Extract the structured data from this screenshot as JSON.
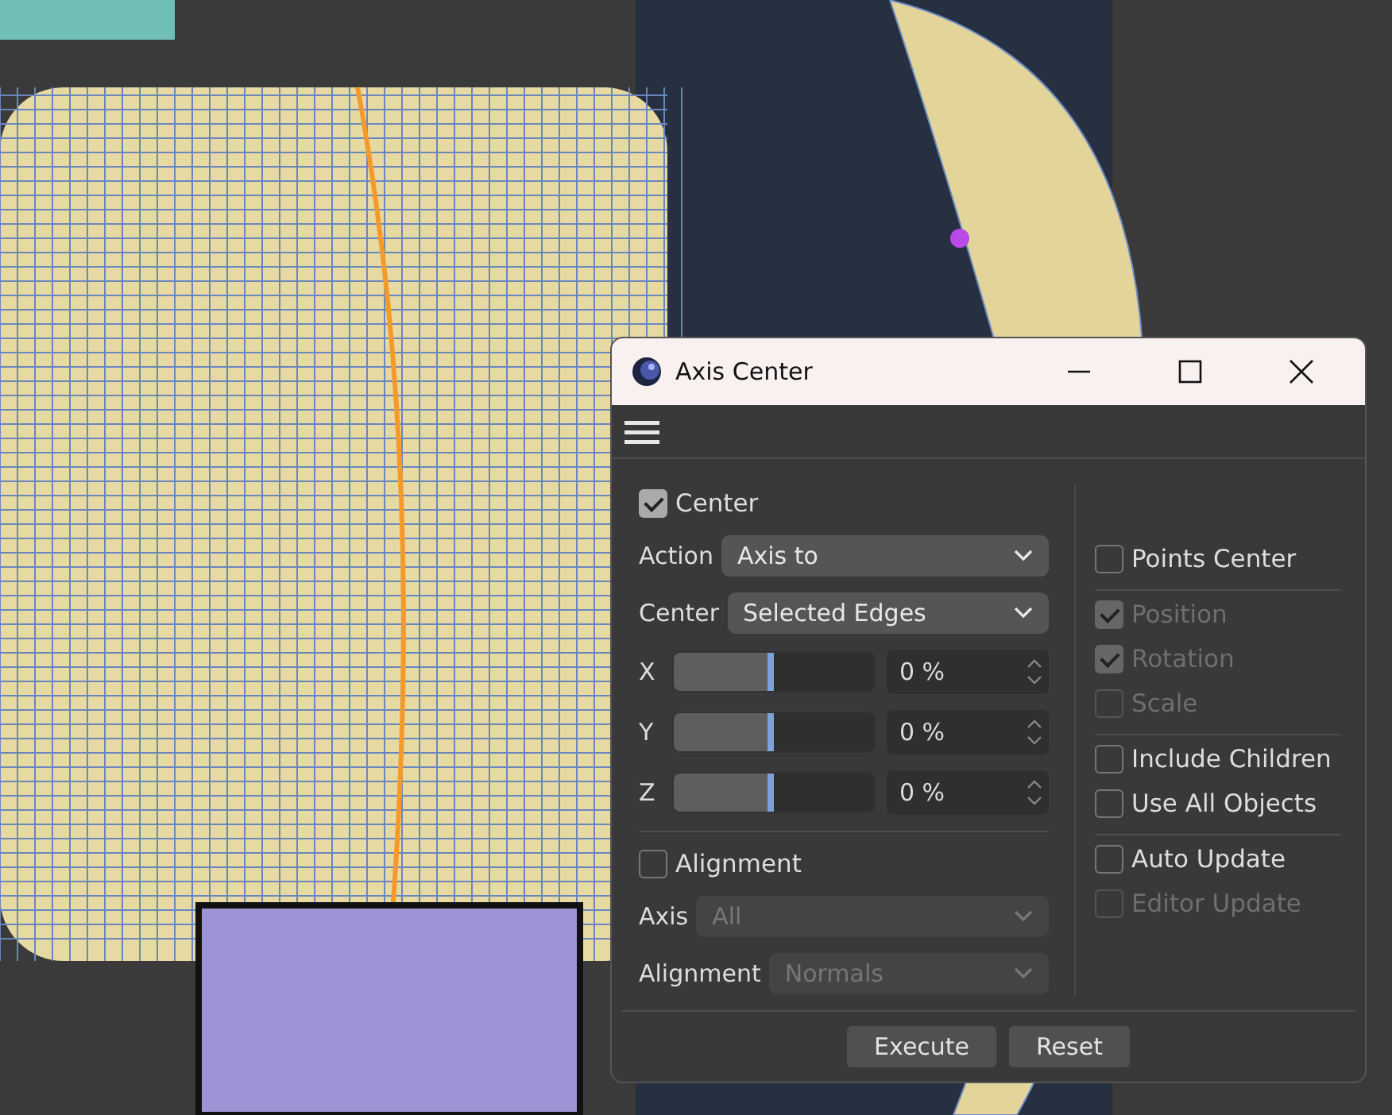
{
  "window": {
    "title": "Axis Center"
  },
  "center": {
    "label": "Center",
    "checked": true
  },
  "dropdowns": [
    {
      "label": "Action",
      "value": "Axis to",
      "disabled": false
    },
    {
      "label": "Center",
      "value": "Selected Edges",
      "disabled": false
    }
  ],
  "sliders": [
    {
      "label": "X",
      "level": 0.5,
      "value": "0 %"
    },
    {
      "label": "Y",
      "level": 0.5,
      "value": "0 %"
    },
    {
      "label": "Z",
      "level": 0.5,
      "value": "0 %"
    }
  ],
  "alignment": {
    "label": "Alignment",
    "checked": false
  },
  "alignment_dropdowns": [
    {
      "label": "Axis",
      "value": "All",
      "disabled": true
    },
    {
      "label": "Alignment",
      "value": "Normals",
      "disabled": true
    }
  ],
  "options": [
    [
      {
        "label": "Points Center",
        "checked": false,
        "disabled": false
      }
    ],
    [
      {
        "label": "Position",
        "checked": true,
        "disabled": true
      },
      {
        "label": "Rotation",
        "checked": true,
        "disabled": true
      },
      {
        "label": "Scale",
        "checked": false,
        "disabled": true
      }
    ],
    [
      {
        "label": "Include Children",
        "checked": false,
        "disabled": false
      },
      {
        "label": "Use All Objects",
        "checked": false,
        "disabled": false
      }
    ],
    [
      {
        "label": "Auto Update",
        "checked": false,
        "disabled": false
      },
      {
        "label": "Editor Update",
        "checked": false,
        "disabled": true
      }
    ]
  ],
  "buttons": [
    "Execute",
    "Reset"
  ]
}
